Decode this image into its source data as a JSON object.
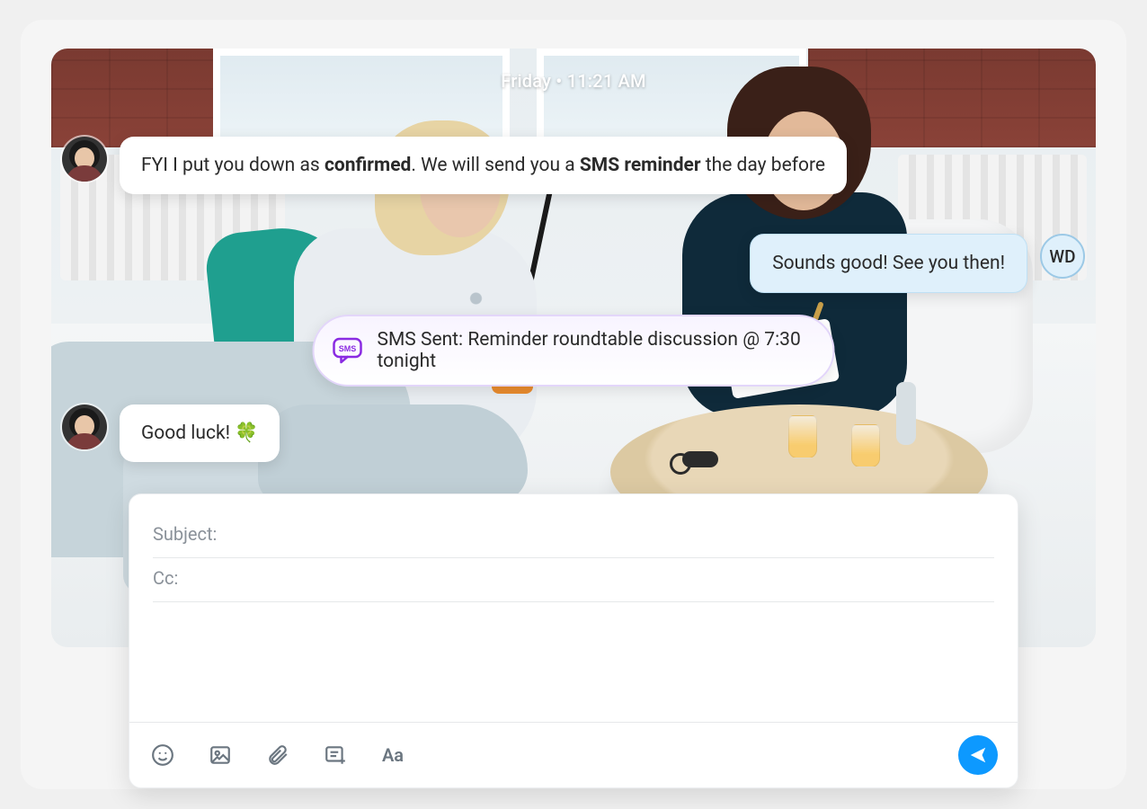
{
  "timestamp": "Friday • 11:21 AM",
  "messages": {
    "m1": {
      "pre": "FYI I put you down as ",
      "bold1": "confirmed",
      "mid": ". We will send you a ",
      "bold2": "SMS reminder",
      "post": " the day before"
    },
    "m2": "Sounds good! See you then!",
    "m3": "Good luck! 🍀"
  },
  "recipient_initials": "WD",
  "sms_notice": "SMS Sent: Reminder roundtable discussion @ 7:30 tonight",
  "composer": {
    "subject_label": "Subject:",
    "cc_label": "Cc:",
    "subject_value": "",
    "cc_value": "",
    "format_label": "Aa"
  }
}
